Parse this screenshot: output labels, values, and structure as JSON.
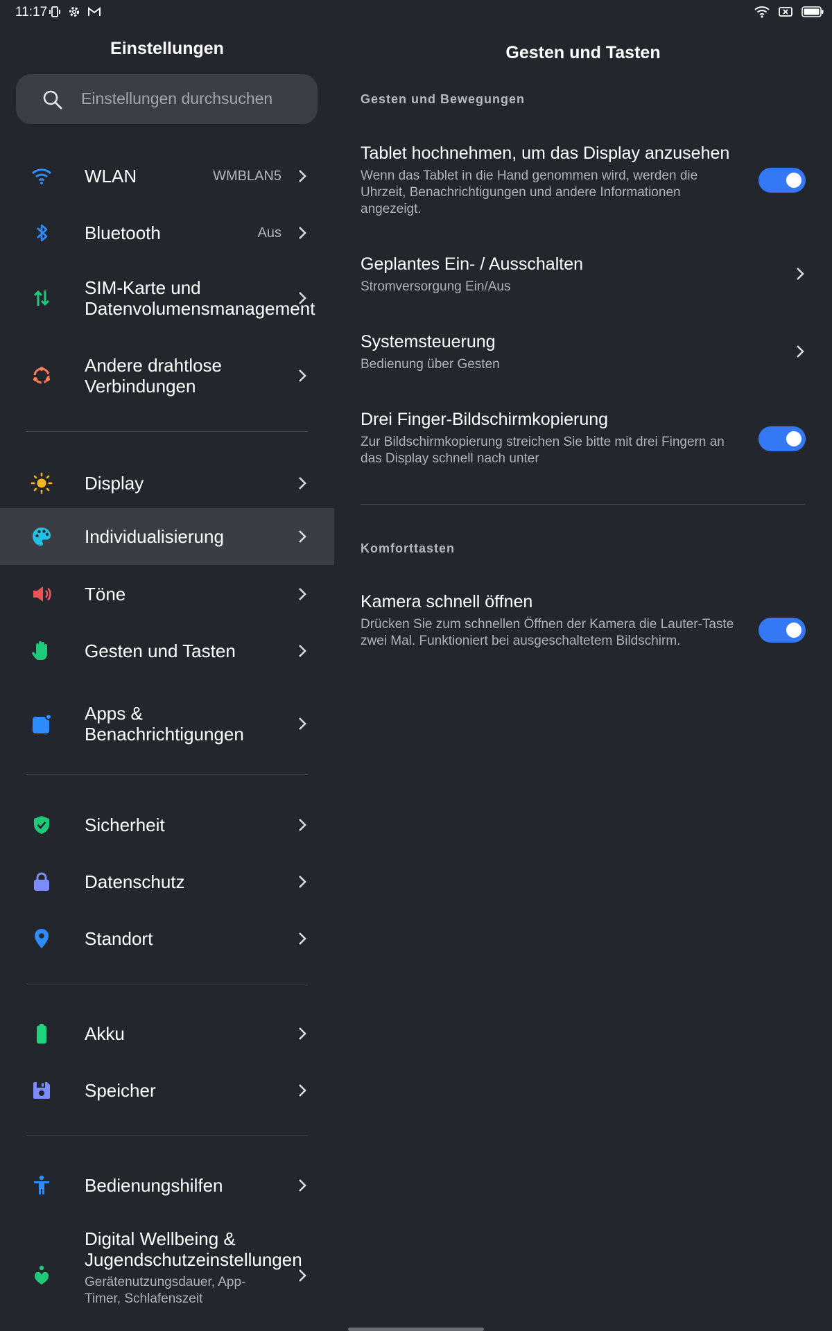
{
  "status_bar": {
    "time": "11:17"
  },
  "left": {
    "title": "Einstellungen",
    "search_placeholder": "Einstellungen durchsuchen",
    "items": [
      {
        "label": "WLAN",
        "value": "WMBLAN5",
        "icon": "wifi-icon"
      },
      {
        "label": "Bluetooth",
        "value": "Aus",
        "icon": "bluetooth-icon"
      },
      {
        "label": "SIM-Karte und Datenvolumensmanagement",
        "icon": "sim-data-icon"
      },
      {
        "label": "Andere drahtlose Verbindungen",
        "icon": "wireless-connections-icon"
      },
      {
        "label": "Display",
        "icon": "brightness-icon"
      },
      {
        "label": "Individualisierung",
        "icon": "palette-icon"
      },
      {
        "label": "Töne",
        "icon": "speaker-icon"
      },
      {
        "label": "Gesten und Tasten",
        "icon": "hand-icon"
      },
      {
        "label": "Apps & Benachrichtigungen",
        "icon": "apps-notifications-icon"
      },
      {
        "label": "Sicherheit",
        "icon": "shield-icon"
      },
      {
        "label": "Datenschutz",
        "icon": "lock-icon"
      },
      {
        "label": "Standort",
        "icon": "location-pin-icon"
      },
      {
        "label": "Akku",
        "icon": "battery-icon"
      },
      {
        "label": "Speicher",
        "icon": "storage-icon"
      },
      {
        "label": "Bedienungshilfen",
        "icon": "accessibility-icon"
      },
      {
        "label": "Digital Wellbeing & Jugendschutzeinstellungen",
        "sub": "Gerätenutzungsdauer, App-Timer, Schlafenszeit",
        "icon": "wellbeing-icon"
      }
    ]
  },
  "right": {
    "title": "Gesten und Tasten",
    "section1": "Gesten und Bewegungen",
    "section2": "Komforttasten",
    "settings": [
      {
        "title": "Tablet hochnehmen, um das Display anzusehen",
        "desc": "Wenn das Tablet in die Hand genommen wird, werden die Uhrzeit, Benachrichtigungen und andere Informationen angezeigt.",
        "enabled": true
      },
      {
        "title": "Geplantes Ein- / Ausschalten",
        "desc": "Stromversorgung Ein/Aus"
      },
      {
        "title": "Systemsteuerung",
        "desc": "Bedienung über Gesten"
      },
      {
        "title": "Drei Finger-Bildschirmkopierung",
        "desc": "Zur Bildschirmkopierung streichen Sie bitte mit drei Fingern an das Display schnell nach unter",
        "enabled": true
      },
      {
        "title": "Kamera schnell öffnen",
        "desc": "Drücken Sie zum schnellen Öffnen der Kamera die Lauter-Taste zwei Mal. Funktioniert bei ausgeschaltetem Bildschirm.",
        "enabled": true
      }
    ]
  },
  "colors": {
    "background": "#23272d",
    "active_row": "#3a3e44",
    "toggle_on": "#3478f6"
  }
}
